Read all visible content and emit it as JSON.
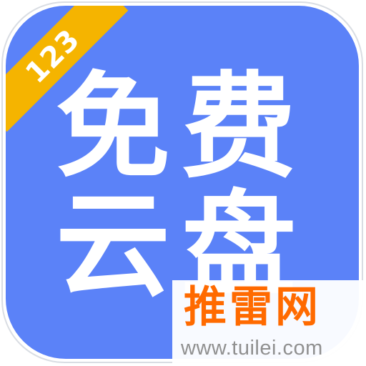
{
  "app_icon": {
    "badge_text": "123",
    "title_line_1": "免费",
    "title_line_2": "云盘",
    "colors": {
      "background": "#5b82f8",
      "badge": "#f5b400",
      "text": "#ffffff"
    }
  },
  "watermark": {
    "title": "推雷网",
    "url": "www.tuilei.com",
    "colors": {
      "title": "#ff6a00",
      "url": "#909090"
    }
  }
}
